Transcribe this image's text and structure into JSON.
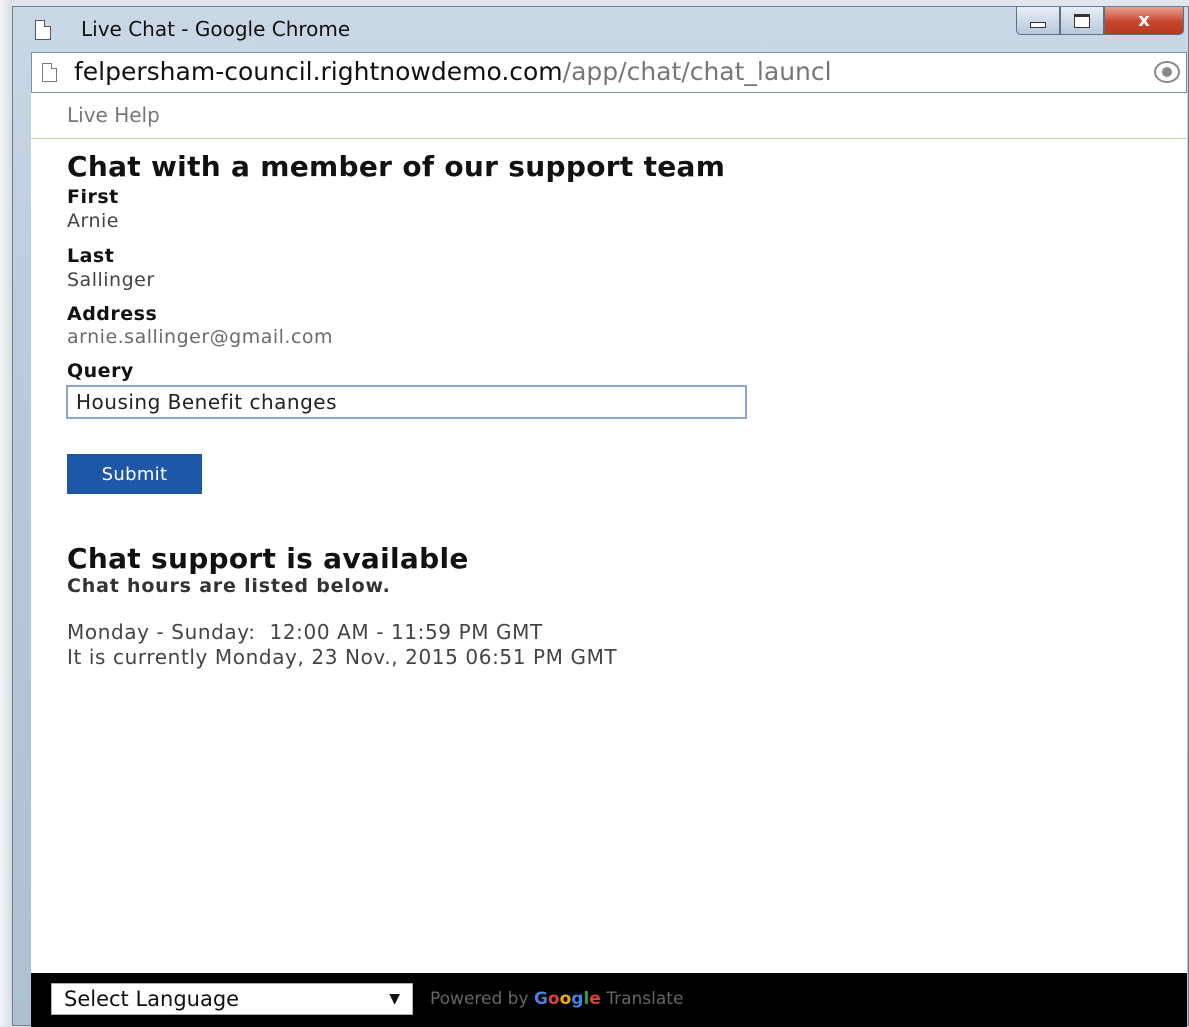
{
  "window": {
    "title": "Live Chat - Google Chrome",
    "close_glyph": "x"
  },
  "address_bar": {
    "host": "felpersham-council.rightnowdemo.com",
    "path": "/app/chat/chat_launcl"
  },
  "page": {
    "header_link": "Live Help",
    "heading": "Chat with a member of our support team",
    "form": {
      "first_label": "First",
      "first_value": "Arnie",
      "last_label": "Last",
      "last_value": "Sallinger",
      "address_label": "Address",
      "address_value": "arnie.sallinger@gmail.com",
      "query_label": "Query",
      "query_value": "Housing Benefit changes",
      "submit_label": "Submit"
    },
    "availability": {
      "heading": "Chat support is available",
      "subheading": "Chat hours are listed below.",
      "hours_line": "Monday - Sunday:  12:00 AM - 11:59 PM GMT",
      "current_time_line": "It is currently Monday, 23 Nov., 2015 06:51 PM GMT"
    }
  },
  "translate": {
    "select_value": "Select Language",
    "powered_by": "Powered by",
    "google_letters": [
      "G",
      "o",
      "o",
      "g",
      "l",
      "e"
    ],
    "translate_word": "Translate"
  },
  "colors": {
    "submit_bg": "#1e57a8",
    "divider": "#b7dba7",
    "input_border": "#8aa6cc"
  }
}
